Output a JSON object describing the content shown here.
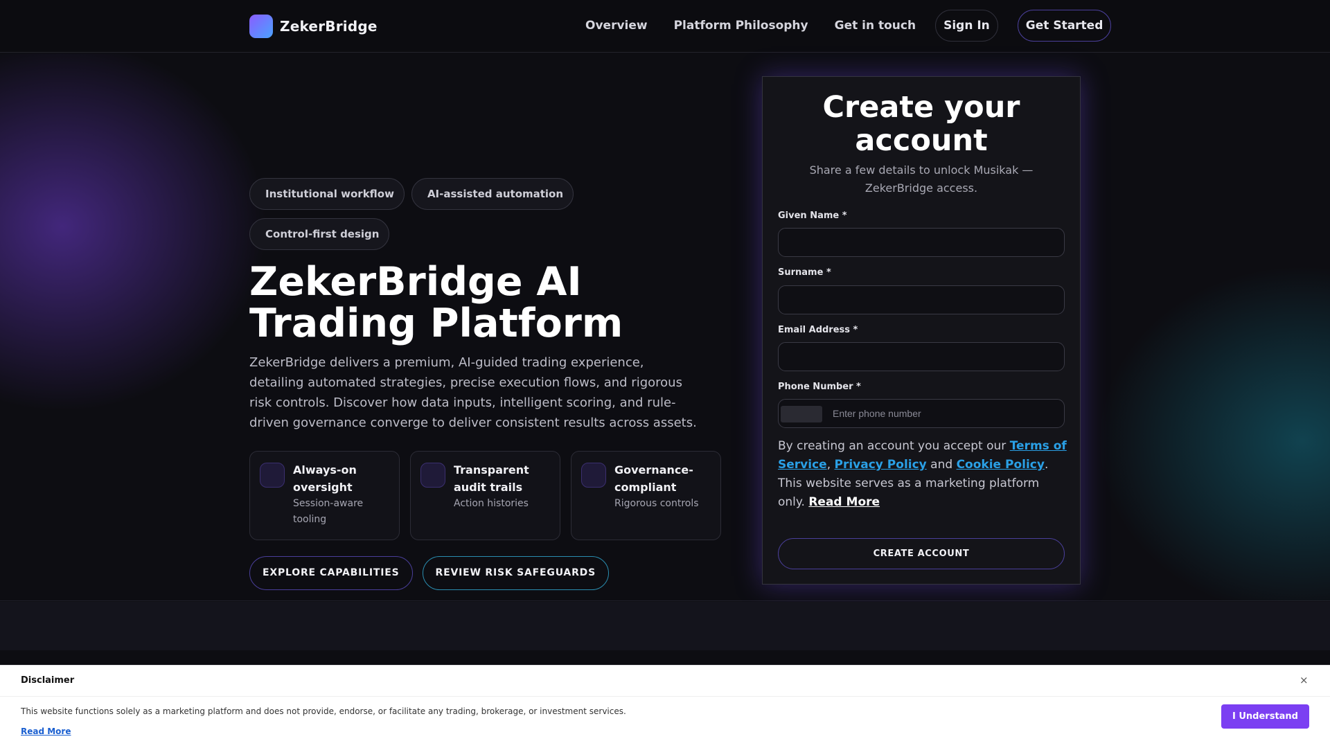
{
  "header": {
    "brand": "ZekerBridge",
    "nav": [
      "Overview",
      "Platform Philosophy",
      "Get in touch"
    ],
    "sign_in": "Sign In",
    "get_started": "Get Started"
  },
  "hero": {
    "chips": [
      "Institutional workflow",
      "AI-assisted automation",
      "Control-first design"
    ],
    "chip_icon": "",
    "title": "ZekerBridge AI Trading Platform",
    "description": "ZekerBridge delivers a premium, AI-guided trading experience, detailing automated strategies, precise execution flows, and rigorous risk controls. Discover how data inputs, intelligent scoring, and rule-driven governance converge to deliver consistent results across assets.",
    "features": [
      {
        "title": "Always-on oversight",
        "sub": "Session-aware tooling"
      },
      {
        "title": "Transparent audit trails",
        "sub": "Action histories"
      },
      {
        "title": "Governance-compliant",
        "sub": "Rigorous controls"
      }
    ],
    "cta_primary": "EXPLORE CAPABILITIES",
    "cta_secondary": "REVIEW RISK SAFEGUARDS"
  },
  "form": {
    "title": "Create your account",
    "subtitle": "Share a few details to unlock Musikak — ZekerBridge access.",
    "given_name_label": "Given Name *",
    "surname_label": "Surname *",
    "email_label": "Email Address *",
    "phone_label": "Phone Number *",
    "phone_placeholder": "Enter phone number",
    "consent_prefix": "By creating an account you accept our ",
    "terms": "Terms of Service",
    "sep_comma": ", ",
    "privacy": "Privacy Policy",
    "sep_and": " and ",
    "cookie": "Cookie Policy",
    "consent_suffix": ". This website serves as a marketing platform only. ",
    "read_more": "Read More",
    "submit": "CREATE ACCOUNT"
  },
  "disclaimer": {
    "title": "Disclaimer",
    "close": "×",
    "text": "This website functions solely as a marketing platform and does not provide, endorse, or facilitate any trading, brokerage, or investment services.",
    "read_more": "Read More",
    "button": "I Understand"
  },
  "icons": {
    "brand_logo": "gradient-square-logo",
    "chip_icon": "dot-icon",
    "feature_icon": "square-icon",
    "close_icon": "close-icon"
  },
  "colors": {
    "accent_purple": "#7b3ff2",
    "link_blue": "#2aa0e6",
    "background": "#0d0d12"
  }
}
